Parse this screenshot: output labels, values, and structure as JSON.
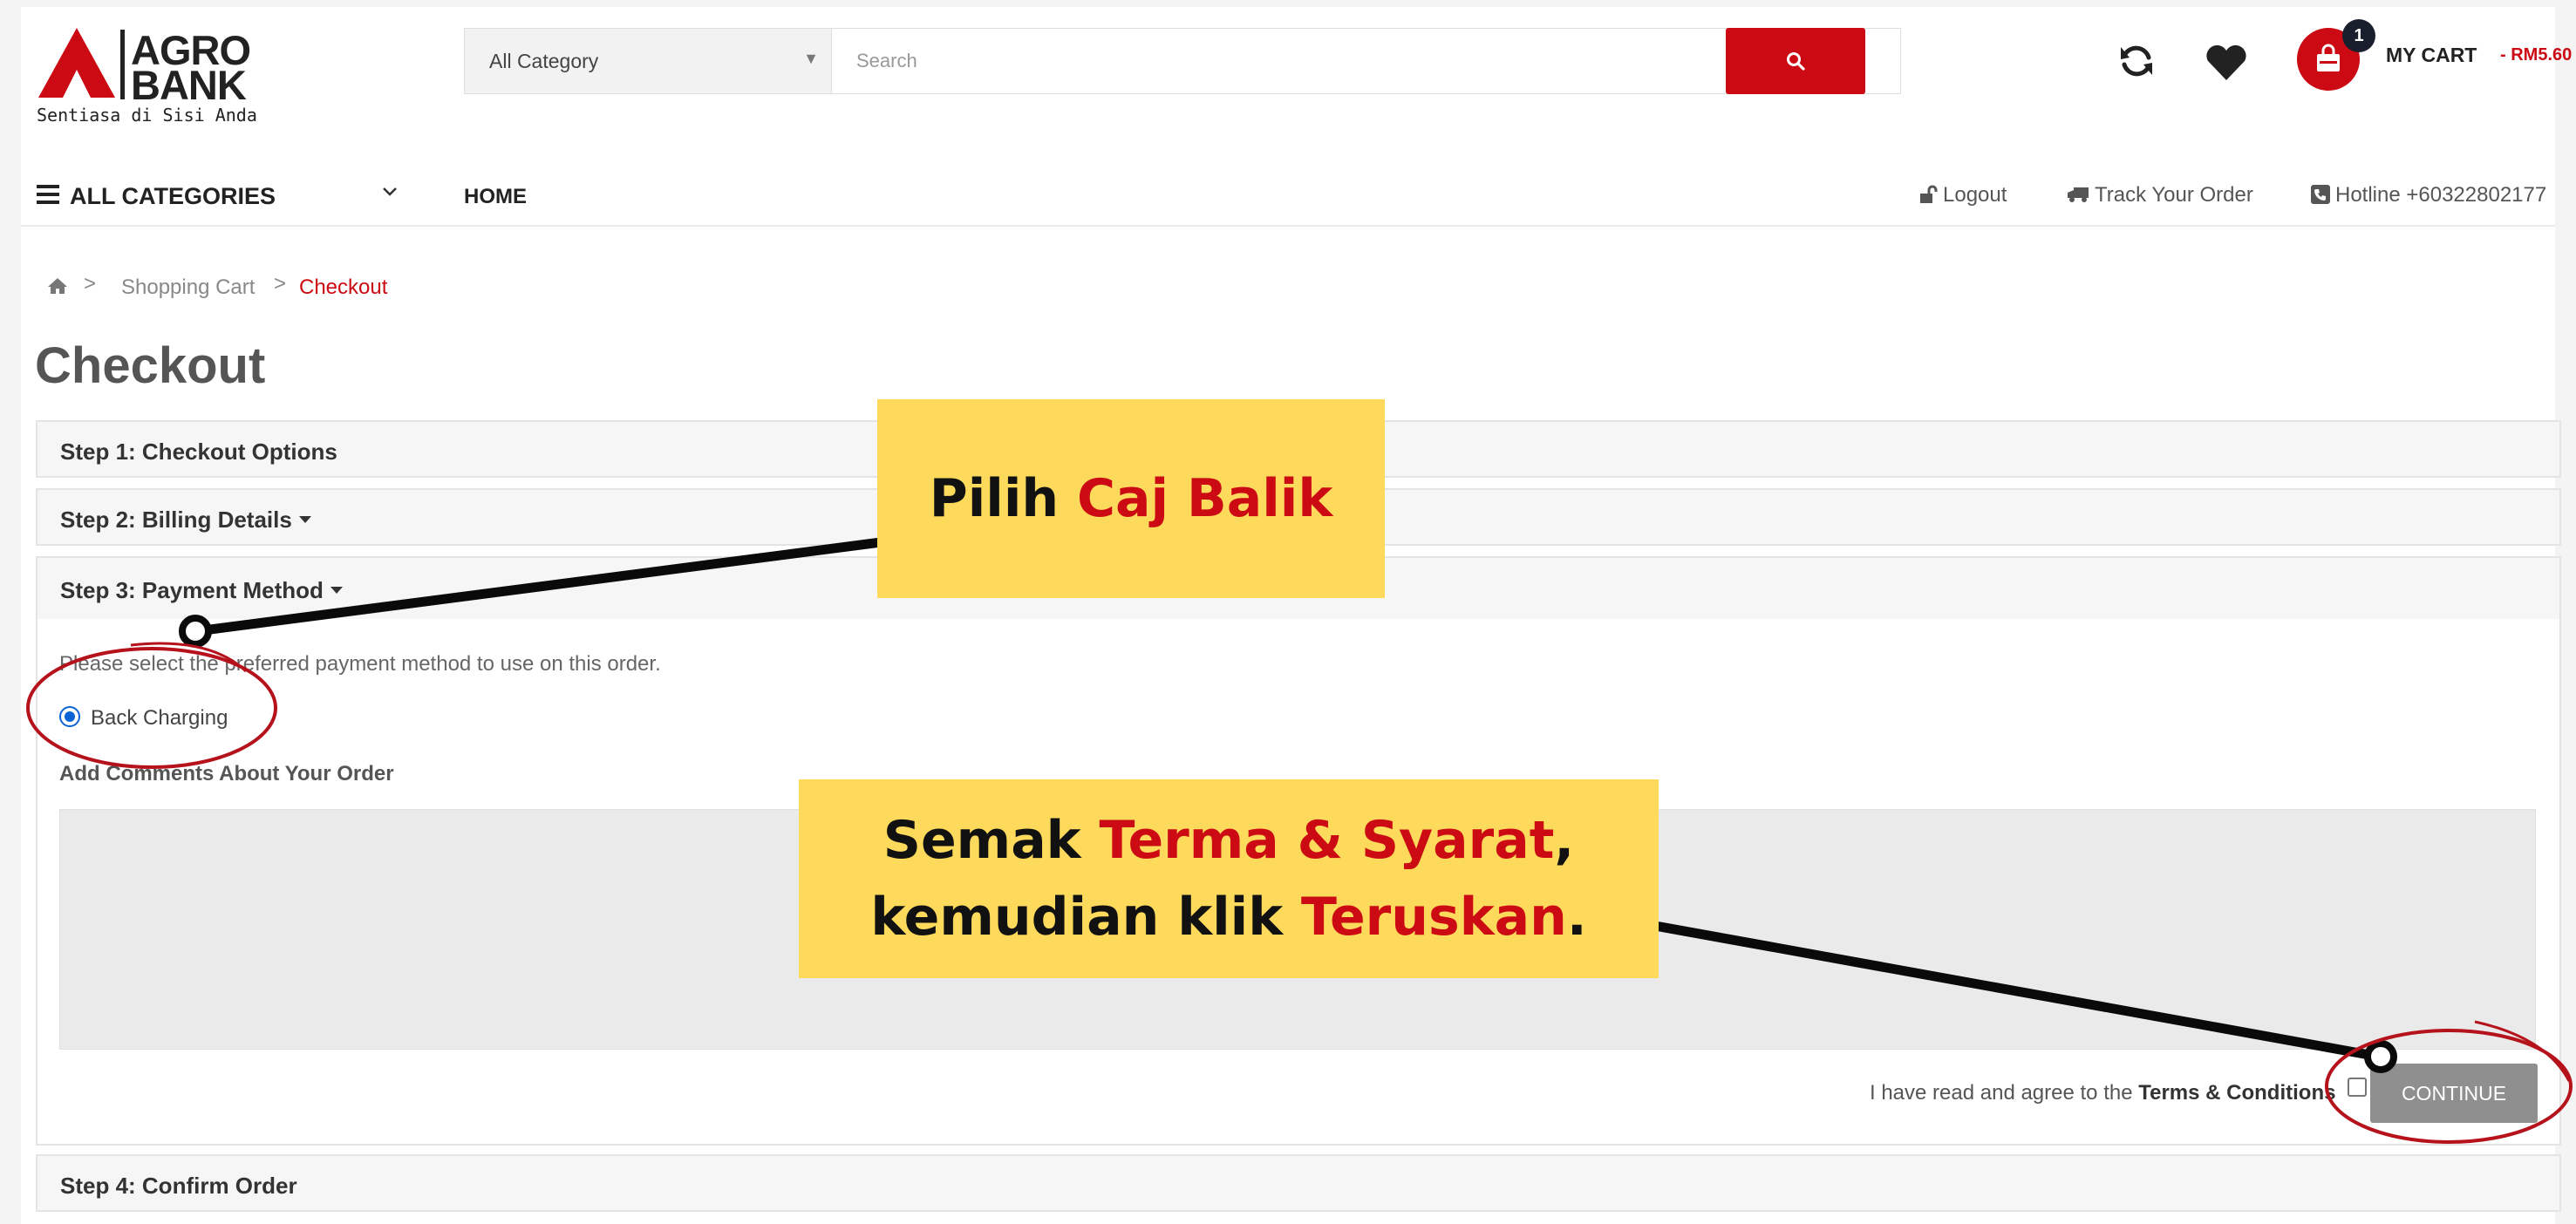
{
  "brand": {
    "name_line1": "AGRO",
    "name_line2": "BANK",
    "tagline": "Sentiasa di Sisi Anda",
    "accent_color": "#cc0a13"
  },
  "search": {
    "category_label": "All Category",
    "placeholder": "Search",
    "button_icon": "search-icon"
  },
  "header_icons": [
    "refresh-icon",
    "heart-icon",
    "shopping-bag-icon"
  ],
  "cart": {
    "count": "1",
    "label": "MY CART",
    "amount": "- RM5.60"
  },
  "nav": {
    "all_categories": "ALL CATEGORIES",
    "home": "HOME",
    "logout": "Logout",
    "track_order": "Track Your Order",
    "hotline": "Hotline +60322802177"
  },
  "breadcrumb": {
    "items": [
      "Shopping Cart",
      "Checkout"
    ],
    "separator": ">"
  },
  "page_title": "Checkout",
  "steps": [
    {
      "label": "Step 1: Checkout Options"
    },
    {
      "label": "Step 2: Billing Details"
    },
    {
      "label": "Step 3: Payment Method"
    },
    {
      "label": "Step 4: Confirm Order"
    }
  ],
  "payment": {
    "help_text": "Please select the preferred payment method to use on this order.",
    "option_label": "Back Charging",
    "option_selected": true,
    "comments_label": "Add Comments About Your Order",
    "comments_value": ""
  },
  "agreement": {
    "prefix": "I have read and agree to the ",
    "link": "Terms & Conditions",
    "checked": false
  },
  "continue_label": "CONTINUE",
  "annotations": {
    "callout1": {
      "plain": "Pilih ",
      "highlight": "Caj Balik"
    },
    "callout2": {
      "line1_plain": "Semak ",
      "line1_highlight": "Terma & Syarat",
      "line1_end": ",",
      "line2_plain": "kemudian klik ",
      "line2_highlight": "Teruskan",
      "line2_end": "."
    },
    "callout_bg": "#fdda5c",
    "ring_color": "#b5121b"
  }
}
